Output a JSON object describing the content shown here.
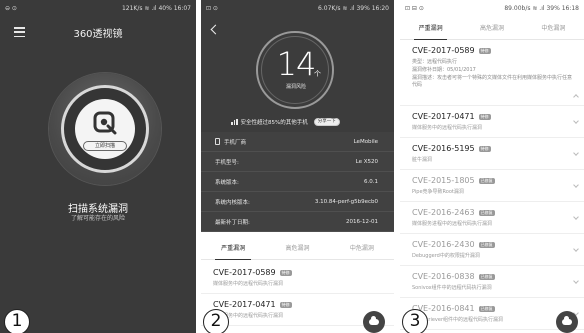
{
  "panel1": {
    "status": {
      "left": "⊖ ⊙",
      "right": "121K/s ≋ .ıl 40% 16:07"
    },
    "title": "360透视镜",
    "scan_button": "立即扫描",
    "main_text": "扫描系统漏洞",
    "sub_text": "了解可能存在的风险",
    "number": "1"
  },
  "panel2": {
    "status": {
      "left": "⊡ ⊙",
      "right": "6.07K/s ≋ .ıl 39% 16:20"
    },
    "risk_count": "14",
    "risk_unit": "个",
    "risk_label": "漏洞风险",
    "safety_text": "安全性超过85%的其他手机",
    "share_label": "分享一下",
    "info": [
      {
        "key": "手机厂商",
        "value": "LeMobile"
      },
      {
        "key": "手机型号:",
        "value": "Le X520"
      },
      {
        "key": "系统版本:",
        "value": "6.0.1"
      },
      {
        "key": "系统内核版本:",
        "value": "3.10.84-perf-g5b9ecb0"
      },
      {
        "key": "最新补丁日期:",
        "value": "2016-12-01"
      }
    ],
    "tabs": [
      "严重漏洞",
      "高危漏洞",
      "中危漏洞"
    ],
    "vulns": [
      {
        "id": "CVE-2017-0589",
        "badge": "待修",
        "desc": "媒体服务中的远程代码执行漏洞"
      },
      {
        "id": "CVE-2017-0471",
        "badge": "待修",
        "desc": "媒体服务中的远程代码执行漏洞"
      }
    ],
    "number": "2"
  },
  "panel3": {
    "status": {
      "left": "⊡ ⊟ ⊙",
      "right": "89.00b/s ≋ .ıl 39% 16:18"
    },
    "tabs": [
      "严重漏洞",
      "高危漏洞",
      "中危漏洞"
    ],
    "expanded": {
      "id": "CVE-2017-0589",
      "badge": "待修",
      "type": "类型：远程代码执行",
      "deadline": "漏洞修补日期：05/01/2017",
      "description": "漏洞描述：攻击者可将一个特殊的文媒体文件在利用媒体服务中执行任意代码"
    },
    "vulns": [
      {
        "id": "CVE-2017-0471",
        "badge": "待修",
        "desc": "媒体服务中的远程代码执行漏洞",
        "muted": false
      },
      {
        "id": "CVE-2016-5195",
        "badge": "待修",
        "desc": "脏牛漏洞",
        "muted": false
      },
      {
        "id": "CVE-2015-1805",
        "badge": "已修复",
        "desc": "Pipe竞争导致Root漏洞",
        "muted": true
      },
      {
        "id": "CVE-2016-2463",
        "badge": "已修复",
        "desc": "媒体服务进程中的远程代码执行漏洞",
        "muted": true
      },
      {
        "id": "CVE-2016-2430",
        "badge": "已修复",
        "desc": "Debuggerd中的权限提升漏洞",
        "muted": true
      },
      {
        "id": "CVE-2016-0838",
        "badge": "已修复",
        "desc": "Sonivox组件中的远程代码执行漏洞",
        "muted": true
      },
      {
        "id": "CVE-2016-0841",
        "badge": "已修复",
        "desc": "etaRetriever组件中的远程代码执行漏洞",
        "muted": true
      }
    ],
    "number": "3"
  },
  "colors": {
    "dark_bg": "#3a3a3a",
    "accent": "#333333"
  }
}
